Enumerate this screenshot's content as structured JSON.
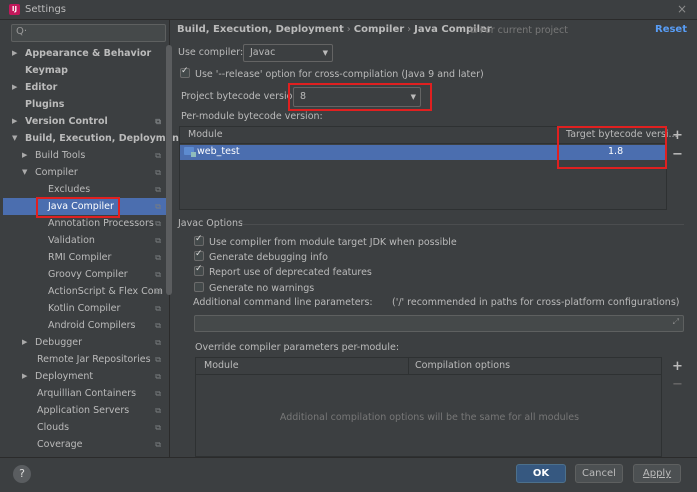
{
  "window": {
    "title": "Settings",
    "close": "×",
    "icon_text": "IJ"
  },
  "search": {
    "placeholder": "Q·",
    "icon": "search-icon"
  },
  "sidebar": {
    "items": [
      {
        "label": "Appearance & Behavior",
        "bold": true,
        "arrow": "▶"
      },
      {
        "label": "Keymap",
        "bold": true
      },
      {
        "label": "Editor",
        "bold": true,
        "arrow": "▶"
      },
      {
        "label": "Plugins",
        "bold": true
      },
      {
        "label": "Version Control",
        "bold": true,
        "arrow": "▶"
      },
      {
        "label": "Build, Execution, Deployment",
        "bold": true,
        "arrow": "▼"
      },
      {
        "label": "Build Tools",
        "arrow": "▶"
      },
      {
        "label": "Compiler",
        "arrow": "▼"
      },
      {
        "label": "Excludes"
      },
      {
        "label": "Java Compiler",
        "selected": true
      },
      {
        "label": "Annotation Processors"
      },
      {
        "label": "Validation"
      },
      {
        "label": "RMI Compiler"
      },
      {
        "label": "Groovy Compiler"
      },
      {
        "label": "ActionScript & Flex Com"
      },
      {
        "label": "Kotlin Compiler"
      },
      {
        "label": "Android Compilers"
      },
      {
        "label": "Debugger",
        "arrow": "▶"
      },
      {
        "label": "Remote Jar Repositories"
      },
      {
        "label": "Deployment",
        "arrow": "▶"
      },
      {
        "label": "Arquillian Containers"
      },
      {
        "label": "Application Servers"
      },
      {
        "label": "Clouds"
      },
      {
        "label": "Coverage"
      }
    ],
    "config_icon": "⧉"
  },
  "header": {
    "breadcrumb": [
      "Build, Execution, Deployment",
      "Compiler",
      "Java Compiler"
    ],
    "separator": "›",
    "for_current_project": "For current project",
    "reset": "Reset"
  },
  "compiler": {
    "use_compiler_label": "Use compiler:",
    "use_compiler_value": "Javac",
    "release_option_label": "Use '--release' option for cross-compilation (Java 9 and later)",
    "release_option_checked": true,
    "bytecode_label": "Project bytecode version:",
    "bytecode_value": "8",
    "per_module_label": "Per-module bytecode version:"
  },
  "module_table": {
    "columns": [
      "Module",
      "Target bytecode versi..."
    ],
    "rows": [
      {
        "module": "web_test",
        "target": "1.8"
      }
    ],
    "add": "+",
    "remove": "−"
  },
  "javac": {
    "section_label": "Javac Options",
    "options": [
      {
        "label": "Use compiler from module target JDK when possible",
        "checked": true
      },
      {
        "label": "Generate debugging info",
        "checked": true
      },
      {
        "label": "Report use of deprecated features",
        "checked": true
      },
      {
        "label": "Generate no warnings",
        "checked": false
      }
    ],
    "additional_params_label": "Additional command line parameters:",
    "additional_params_hint": "('/' recommended in paths for cross-platform configurations)",
    "additional_params_value": "",
    "override_label": "Override compiler parameters per-module:",
    "override_columns": [
      "Module",
      "Compilation options"
    ],
    "override_empty": "Additional compilation options will be the same for all modules",
    "add": "+",
    "remove": "−"
  },
  "buttons": {
    "ok": "OK",
    "cancel": "Cancel",
    "apply": "Apply",
    "help": "?"
  },
  "colors": {
    "selection": "#4b6eaf",
    "link": "#589df6",
    "annotation": "#e02020",
    "primary": "#365880"
  }
}
